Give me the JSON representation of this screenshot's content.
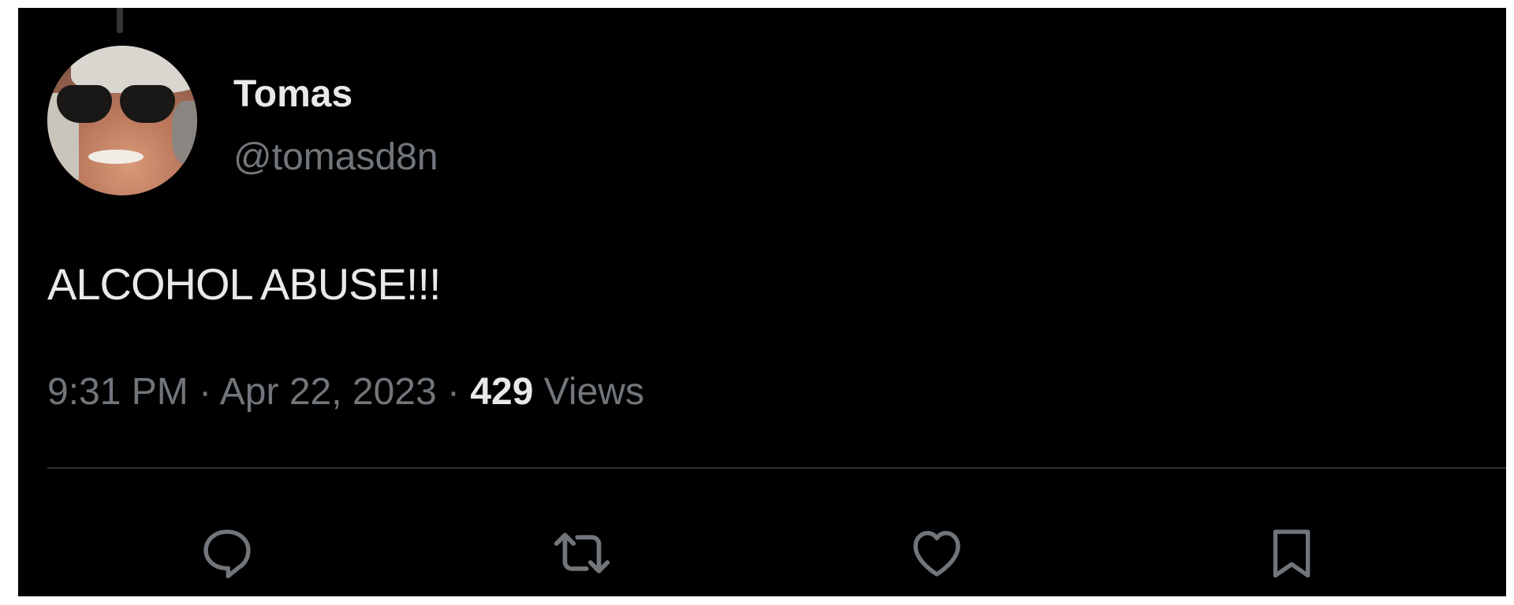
{
  "tweet": {
    "author": {
      "name": "Tomas",
      "handle": "@tomasd8n"
    },
    "text": "ALCOHOL ABUSE!!!",
    "time": "9:31 PM",
    "date": "Apr 22, 2023",
    "separator": "·",
    "views_count": "429",
    "views_label": "Views"
  },
  "actions": [
    {
      "name": "reply",
      "icon": "reply-icon"
    },
    {
      "name": "retweet",
      "icon": "retweet-icon"
    },
    {
      "name": "like",
      "icon": "heart-icon"
    },
    {
      "name": "bookmark",
      "icon": "bookmark-icon"
    }
  ],
  "colors": {
    "background": "#000000",
    "primary_text": "#e7e9ea",
    "secondary_text": "#71767b",
    "divider": "#2f3336"
  }
}
